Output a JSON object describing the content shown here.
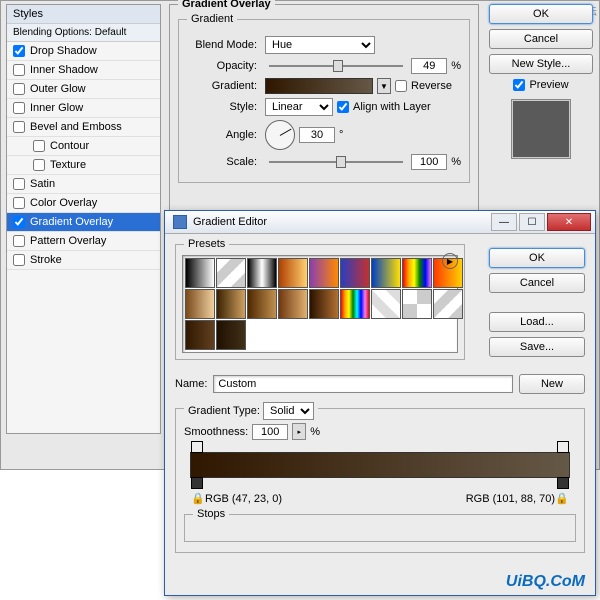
{
  "watermark_top": "思维设计论坛",
  "watermark_bottom": "UiBQ.CoM",
  "layerStyle": {
    "stylesHeader": "Styles",
    "blendingOptions": "Blending Options: Default",
    "items": [
      {
        "label": "Drop Shadow",
        "checked": true
      },
      {
        "label": "Inner Shadow",
        "checked": false
      },
      {
        "label": "Outer Glow",
        "checked": false
      },
      {
        "label": "Inner Glow",
        "checked": false
      },
      {
        "label": "Bevel and Emboss",
        "checked": false
      },
      {
        "label": "Contour",
        "checked": false,
        "indent": true
      },
      {
        "label": "Texture",
        "checked": false,
        "indent": true
      },
      {
        "label": "Satin",
        "checked": false
      },
      {
        "label": "Color Overlay",
        "checked": false
      },
      {
        "label": "Gradient Overlay",
        "checked": true,
        "selected": true
      },
      {
        "label": "Pattern Overlay",
        "checked": false
      },
      {
        "label": "Stroke",
        "checked": false
      }
    ],
    "panelTitle": "Gradient Overlay",
    "groupTitle": "Gradient",
    "blendModeLabel": "Blend Mode:",
    "blendModeValue": "Hue",
    "opacityLabel": "Opacity:",
    "opacityValue": "49",
    "pct": "%",
    "gradientLabel": "Gradient:",
    "reverseLabel": "Reverse",
    "styleLabel": "Style:",
    "styleValue": "Linear",
    "alignLabel": "Align with Layer",
    "angleLabel": "Angle:",
    "angleValue": "30",
    "deg": "°",
    "scaleLabel": "Scale:",
    "scaleValue": "100",
    "buttons": {
      "ok": "OK",
      "cancel": "Cancel",
      "newStyle": "New Style...",
      "preview": "Preview"
    }
  },
  "gradientEditor": {
    "title": "Gradient Editor",
    "presetsLabel": "Presets",
    "presets": [
      "linear-gradient(90deg,#000,#fff)",
      "linear-gradient(135deg,#fff 25%,#ccc 25%,#ccc 50%,#fff 50%,#fff 75%,#ccc 75%)",
      "linear-gradient(90deg,#000,#fff,#000)",
      "linear-gradient(90deg,#b04000,#ffd070)",
      "linear-gradient(90deg,#8a3eb0,#ff8a00)",
      "linear-gradient(90deg,#2a3ec0,#c43030)",
      "linear-gradient(90deg,#0040c0,#ffe000)",
      "linear-gradient(90deg,red,orange,yellow,green,blue,violet)",
      "linear-gradient(90deg,#ff3a00,#ffd000)",
      "linear-gradient(90deg,#7a4a1a,#f0d0a0)",
      "linear-gradient(90deg,#3a2200,#d0a060)",
      "linear-gradient(90deg,#502800,#c09050)",
      "linear-gradient(90deg,#703810,#e0b070)",
      "linear-gradient(90deg,#2a1200,#b07030)",
      "linear-gradient(90deg,red,orange,yellow,green,cyan,blue,violet,red)",
      "linear-gradient(45deg,#fff 25%,#ddd 25%,#ddd 50%,#fff 50%,#fff 75%,#ddd 75%)",
      "repeating-conic-gradient(#ccc 0 25%,#fff 0 50%)",
      "linear-gradient(135deg,#fff 25%,#ccc 25%,#ccc 50%,#fff 50%,#fff 75%,#ccc 75%)",
      "linear-gradient(90deg,#301800,#604020)",
      "linear-gradient(90deg,#201000,#403018)"
    ],
    "buttons": {
      "ok": "OK",
      "cancel": "Cancel",
      "load": "Load...",
      "save": "Save...",
      "new": "New"
    },
    "nameLabel": "Name:",
    "nameValue": "Custom",
    "gradientTypeLabel": "Gradient Type:",
    "gradientTypeValue": "Solid",
    "smoothnessLabel": "Smoothness:",
    "smoothnessValue": "100",
    "pct": "%",
    "rgbLeft": "RGB (47, 23, 0)",
    "rgbRight": "RGB (101, 88, 70)",
    "stopsLabel": "Stops"
  }
}
